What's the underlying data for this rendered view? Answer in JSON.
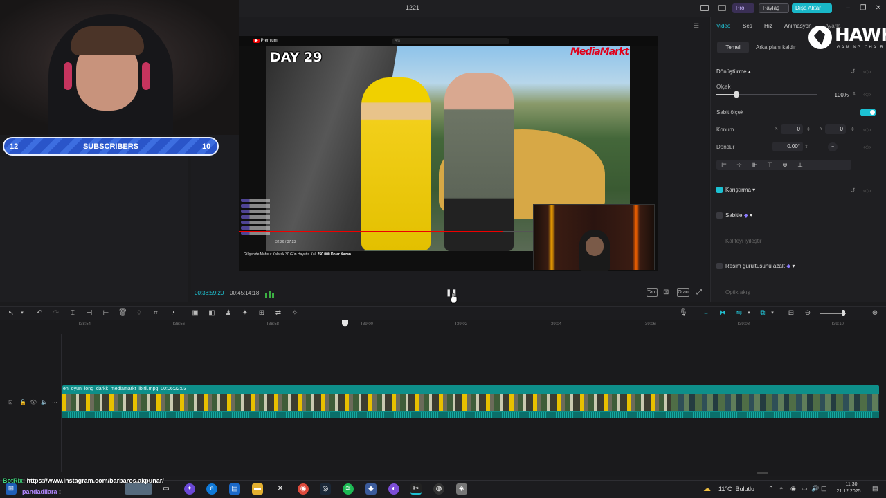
{
  "window": {
    "title": "1221",
    "pro_label": "Pro",
    "share_label": "Paylaş",
    "export_label": "Dışa Aktar"
  },
  "overlay": {
    "subscribers": {
      "left": "12",
      "label": "SUBSCRIBERS",
      "right": "10"
    },
    "botrix": {
      "user": "BotRix",
      "message": ": https://www.instagram.com/barbaros.akpunar/"
    },
    "chat_user": {
      "user": "pandadilara",
      "message": " :"
    },
    "brand_logo": {
      "name": "HAWK",
      "tagline": "GAMING CHAIR"
    }
  },
  "preview": {
    "yt_logo": "Premium",
    "yt_search": "Ara",
    "day_text": "DAY 29",
    "brand_text": "MediaMarkt",
    "yt_time": "32:26 / 37:23",
    "caption_prefix": "Gülşen'de Mahsur Kalarak 30 Gün Hayatta Kal, ",
    "caption_bold": "250.000 Dolar Kazan",
    "current_time": "00:38:59:20",
    "total_time": "00:45:14:18",
    "ctl_full": "Tam",
    "ctl_ratio": "Oran"
  },
  "inspector": {
    "tabs": [
      "Video",
      "Ses",
      "Hız",
      "Animasyon",
      "Ayarla"
    ],
    "subtabs": {
      "basic": "Temel",
      "remove_bg": "Arka planı kaldır"
    },
    "transform": {
      "title": "Dönüştürme",
      "scale_label": "Ölçek",
      "scale_value": "100%",
      "scale_fraction": 0.2,
      "uniform_label": "Sabit ölçek",
      "uniform_on": true,
      "position_label": "Konum",
      "x_label": "X",
      "x_value": "0",
      "y_label": "Y",
      "y_value": "0",
      "rotate_label": "Döndür",
      "rotate_value": "0.00°"
    },
    "blend": {
      "label": "Karıştırma",
      "checked": true
    },
    "stabilize": {
      "label": "Sabitle",
      "checked": false
    },
    "enhance": {
      "label": "Kaliteyi iyileştir"
    },
    "denoise": {
      "label": "Resim gürültüsünü azalt",
      "checked": false
    },
    "optical": {
      "label": "Optik akış"
    }
  },
  "timeline": {
    "ticks": [
      "38:54",
      "38:56",
      "38:58",
      "39:00",
      "39:02",
      "39:04",
      "39:06",
      "39:08",
      "39:10"
    ],
    "clip_name": "en_oyun_long_darkk_mediamarkt_ibirli.mpg",
    "clip_duration": "00:06:22:03"
  },
  "taskbar": {
    "weather_temp": "11°C",
    "weather_text": "Bulutlu",
    "time": "11:30",
    "date": "21.12.2025"
  },
  "colors": {
    "accent": "#1cc1d3",
    "export": "#19b7c8",
    "clip": "#0e8f8a",
    "subscriber_bar": "#2a55c9"
  }
}
